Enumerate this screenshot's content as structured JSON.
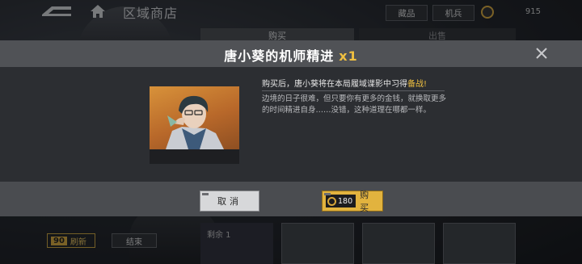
{
  "topbar": {
    "title": "区域商店",
    "collection_label": "藏品",
    "mech_label": "机兵",
    "currency_value": "915"
  },
  "shop_tabs": {
    "buy": "购买",
    "sell": "出售"
  },
  "bottom": {
    "refresh_cost": "90",
    "refresh_label": "刷新",
    "end_label": "结束",
    "remaining_label": "剩余 1"
  },
  "dialog": {
    "title": "唐小葵的机师精进",
    "quantity": "x1",
    "effect_prefix": "购买后，唐小葵将在本局履域谍影中习得",
    "effect_highlight": "备战!",
    "flavor_text": "边境的日子很难，但只要你有更多的金钱，就换取更多的时间精进自身……没错，这种道理在哪都一样。",
    "cancel_label": "取消",
    "buy_price": "180",
    "buy_label": "购买"
  },
  "colors": {
    "accent_gold": "#e2b33e",
    "highlight_yellow": "#f0c040"
  },
  "icons": {
    "back": "back-arrow-icon",
    "home": "home-icon",
    "close": "close-icon",
    "coin": "coin-icon"
  }
}
